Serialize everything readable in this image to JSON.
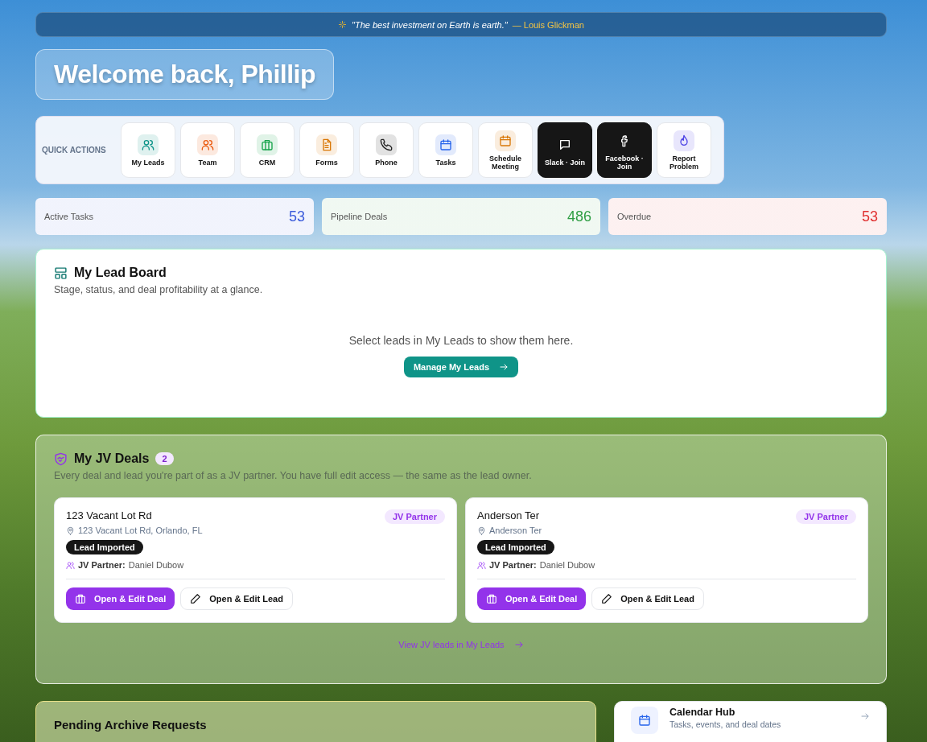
{
  "quote": {
    "text": "\"The best investment on Earth is earth.\"",
    "author": "— Louis Glickman"
  },
  "welcome": {
    "title": "Welcome back, Phillip"
  },
  "quick_actions": {
    "label": "QUICK ACTIONS",
    "items": [
      {
        "label": "My Leads",
        "kind": "tile",
        "color": "#0d9488"
      },
      {
        "label": "Team",
        "kind": "tile",
        "color": "#ea580c"
      },
      {
        "label": "CRM",
        "kind": "tile",
        "color": "#16a34a"
      },
      {
        "label": "Forms",
        "kind": "tile",
        "color": "#d97706"
      },
      {
        "label": "Phone",
        "kind": "tile",
        "color": "#222222"
      },
      {
        "label": "Tasks",
        "kind": "tile",
        "color": "#2563eb"
      },
      {
        "label": "Schedule Meeting",
        "kind": "tile",
        "color": "#d97706"
      },
      {
        "label": "Slack · Join",
        "kind": "dark",
        "color": "#ffffff"
      },
      {
        "label": "Facebook · Join",
        "kind": "dark",
        "color": "#ffffff"
      },
      {
        "label": "Report Problem",
        "kind": "tile",
        "color": "#4f46e5"
      }
    ]
  },
  "stats": [
    {
      "label": "Active Tasks",
      "value": "53",
      "color": "#3b5bdb"
    },
    {
      "label": "Pipeline Deals",
      "value": "486",
      "color": "#2f9e44"
    },
    {
      "label": "Overdue",
      "value": "53",
      "color": "#e03131"
    }
  ],
  "lead_board": {
    "title": "My Lead Board",
    "subtitle": "Stage, status, and deal profitability at a glance.",
    "empty_text": "Select leads in My Leads to show them here.",
    "button": "Manage My Leads"
  },
  "jv_deals": {
    "title": "My JV Deals",
    "count": "2",
    "subtitle": "Every deal and lead you're part of as a JV partner. You have full edit access — the same as the lead owner.",
    "cards": [
      {
        "title": "123 Vacant Lot Rd",
        "badge": "JV Partner",
        "address": "123 Vacant Lot Rd, Orlando, FL",
        "status": "Lead Imported",
        "partner_label": "JV Partner:",
        "partner": "Daniel Dubow",
        "deal_button": "Open & Edit Deal",
        "lead_button": "Open & Edit Lead"
      },
      {
        "title": "Anderson Ter",
        "badge": "JV Partner",
        "address": "Anderson Ter",
        "status": "Lead Imported",
        "partner_label": "JV Partner:",
        "partner": "Daniel Dubow",
        "deal_button": "Open & Edit Deal",
        "lead_button": "Open & Edit Lead"
      }
    ],
    "link": "View JV leads in My Leads"
  },
  "archive": {
    "title": "Pending Archive Requests"
  },
  "calendar_hub": {
    "title": "Calendar Hub",
    "subtitle": "Tasks, events, and deal dates"
  }
}
